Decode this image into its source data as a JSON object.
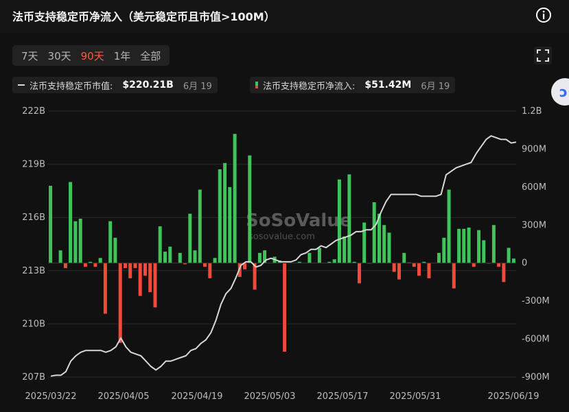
{
  "header": {
    "title": "法币支持稳定币净流入（美元稳定币且市值>100M）"
  },
  "range_tabs": [
    {
      "label": "7天",
      "active": false
    },
    {
      "label": "30天",
      "active": false
    },
    {
      "label": "90天",
      "active": true
    },
    {
      "label": "1年",
      "active": false
    },
    {
      "label": "全部",
      "active": false
    }
  ],
  "legend": {
    "market_cap": {
      "label": "法币支持稳定币市值:",
      "value": "$220.21B",
      "date": "6月 19"
    },
    "net_inflow": {
      "label": "法币支持稳定币净流入:",
      "value": "$51.42M",
      "date": "6月 19"
    }
  },
  "watermark": {
    "brand": "SoSoValue",
    "url": "sosovalue.com"
  },
  "colors": {
    "background": "#111111",
    "positive": "#3ec45a",
    "negative": "#ef4a3a",
    "line": "#d8d8d8",
    "active_tab": "#ff5a3d"
  },
  "chart_data": {
    "type": "bar+line",
    "x_tick_labels": [
      "2025/03/22",
      "2025/04/05",
      "2025/04/19",
      "2025/05/03",
      "2025/05/17",
      "2025/05/31",
      "2025/06/19"
    ],
    "left_axis": {
      "labels": [
        "222B",
        "219B",
        "216B",
        "213B",
        "210B",
        "207B"
      ],
      "ylim": [
        207,
        222
      ],
      "unit": "B"
    },
    "right_axis": {
      "labels": [
        "1.2B",
        "900M",
        "600M",
        "300M",
        "0",
        "-300M",
        "-600M",
        "-900M"
      ],
      "ylim": [
        -900,
        1200
      ],
      "unit": "M"
    },
    "grid": "horizontal",
    "series": [
      {
        "name": "法币支持稳定币净流入",
        "kind": "bar",
        "unit": "M",
        "values": [
          610,
          0,
          100,
          -40,
          640,
          330,
          350,
          -30,
          10,
          -30,
          40,
          -400,
          330,
          200,
          -630,
          -40,
          -120,
          -40,
          -260,
          -100,
          -230,
          -350,
          290,
          90,
          130,
          0,
          80,
          -10,
          390,
          100,
          580,
          -30,
          -120,
          40,
          740,
          790,
          600,
          1020,
          -110,
          -50,
          850,
          -210,
          80,
          100,
          0,
          50,
          20,
          -700,
          0,
          0,
          10,
          0,
          80,
          0,
          120,
          0,
          10,
          30,
          660,
          210,
          700,
          10,
          -160,
          320,
          1,
          480,
          390,
          300,
          240,
          -70,
          -130,
          80,
          5,
          -30,
          -100,
          10,
          -120,
          0,
          80,
          200,
          580,
          -200,
          270,
          270,
          280,
          -30,
          260,
          180,
          1,
          300,
          -30,
          -150,
          120,
          35
        ]
      },
      {
        "name": "法币支持稳定币市值",
        "kind": "line",
        "unit": "B",
        "values": [
          207.05,
          207.1,
          207.1,
          207.3,
          207.9,
          208.2,
          208.4,
          208.5,
          208.5,
          208.5,
          208.5,
          208.4,
          208.5,
          208.7,
          209.2,
          208.7,
          208.4,
          208.3,
          208.2,
          207.9,
          207.6,
          207.4,
          207.6,
          207.9,
          207.9,
          208.0,
          208.1,
          208.2,
          208.5,
          208.6,
          208.9,
          209.1,
          209.5,
          210.2,
          211.1,
          211.7,
          212.0,
          212.6,
          213.3,
          213.5,
          213.5,
          213.2,
          213.3,
          213.6,
          213.7,
          213.6,
          213.5,
          213.5,
          213.5,
          213.6,
          213.9,
          214.0,
          214.2,
          214.2,
          214.4,
          214.3,
          214.5,
          214.7,
          214.8,
          214.9,
          215.0,
          215.2,
          215.2,
          215.3,
          215.3,
          215.6,
          216.3,
          216.9,
          217.3,
          217.3,
          217.3,
          217.3,
          217.3,
          217.3,
          217.2,
          217.2,
          217.2,
          217.2,
          217.3,
          218.4,
          218.6,
          218.8,
          218.9,
          219.0,
          219.1,
          219.6,
          220.0,
          220.4,
          220.6,
          220.5,
          220.4,
          220.4,
          220.2,
          220.25
        ]
      }
    ]
  }
}
